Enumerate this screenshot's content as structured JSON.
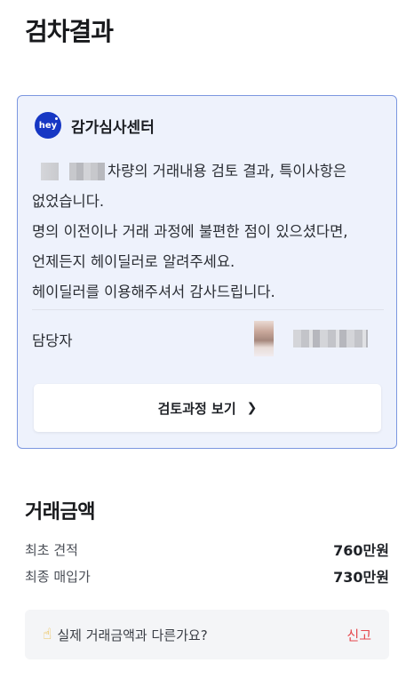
{
  "page": {
    "title": "검차결과"
  },
  "review_card": {
    "logo_text": "hey",
    "center_name": "감가심사센터",
    "message_line1_suffix": "차량의 거래내용 검토 결과, 특이사항은",
    "message_lines": [
      "없었습니다.",
      "명의 이전이나 거래 과정에 불편한 점이 있으셨다면,",
      "언제든지 헤이딜러로 알려주세요.",
      "헤이딜러를 이용해주셔서 감사드립니다."
    ],
    "manager_label": "담당자",
    "button_label": "검토과정 보기",
    "button_icon": "chevron-right-icon",
    "accent_color": "#7c97e0",
    "brand_color": "#1637c4"
  },
  "trade_amount": {
    "title": "거래금액",
    "rows": [
      {
        "label": "최초 견적",
        "value": "760만원"
      },
      {
        "label": "최종 매입가",
        "value": "730만원"
      }
    ]
  },
  "report": {
    "icon": "pointing-hand-icon",
    "question": "실제 거래금액과 다른가요?",
    "link_label": "신고",
    "link_color": "#e5484d"
  }
}
